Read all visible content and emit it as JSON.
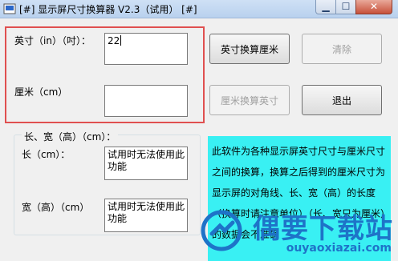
{
  "window": {
    "title": "[#] 显示屏尺寸换算器 V2.3（试用） [#]",
    "minimize_icon": "minimize-icon",
    "maximize_icon": "maximize-icon",
    "close_icon": "close-icon"
  },
  "inputs": {
    "inch_label": "英寸（in）（吋）：",
    "inch_value": "22",
    "cm_label": "厘米（cm）",
    "cm_value": ""
  },
  "buttons": {
    "inch_to_cm": "英寸换算厘米",
    "clear": "清除",
    "cm_to_inch": "厘米换算英寸",
    "exit": "退出"
  },
  "group": {
    "title": "长、宽（高）（cm）：",
    "length_label": "长（cm）：",
    "length_value": "试用时无法使用此功能",
    "width_label": "宽（高）（cm）",
    "width_value": "试用时无法使用此功能"
  },
  "info": {
    "text": "此软件为各种显示屏英寸尺寸与厘米尺寸之间的换算，换算之后得到的厘米尺寸为显示屏的对角线、长、宽（高）的长度（换算时请注意单位）（长、宽只为厘米）的数据会不准确"
  },
  "watermark": {
    "main": "偶要下载站",
    "sub": "ouyaoxiazai.com"
  },
  "colors": {
    "highlight_border": "#e05050",
    "info_bg": "#39f0f3",
    "watermark": "#1e73c8"
  }
}
